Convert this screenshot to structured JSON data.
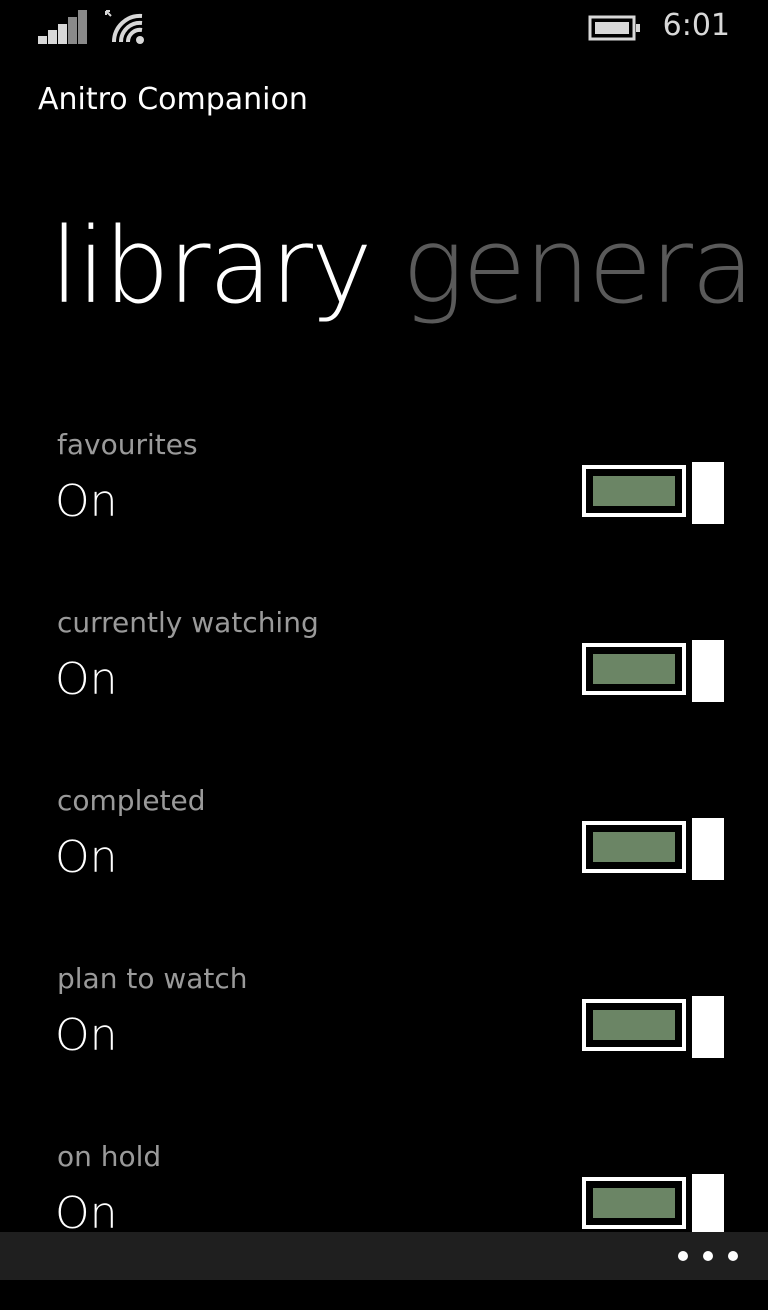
{
  "status_bar": {
    "time": "6:01",
    "icons": [
      "signal-strength-icon",
      "wifi-icon",
      "battery-icon"
    ]
  },
  "app": {
    "title": "Anitro Companion"
  },
  "pivot": {
    "items": [
      {
        "label": "library",
        "active": true
      },
      {
        "label": "genera",
        "active": false
      }
    ]
  },
  "settings": {
    "items": [
      {
        "label": "favourites",
        "value": "On",
        "toggled": true
      },
      {
        "label": "currently watching",
        "value": "On",
        "toggled": true
      },
      {
        "label": "completed",
        "value": "On",
        "toggled": true
      },
      {
        "label": "plan to watch",
        "value": "On",
        "toggled": true
      },
      {
        "label": "on hold",
        "value": "On",
        "toggled": true
      }
    ]
  },
  "app_bar": {
    "more_icon": "more-ellipsis-icon"
  },
  "colors": {
    "background": "#000000",
    "toggle_accent": "#6b8565",
    "label_gray": "#9a9a9a",
    "inactive_pivot": "#5a5a5a",
    "app_bar_bg": "#1f1f1f"
  }
}
